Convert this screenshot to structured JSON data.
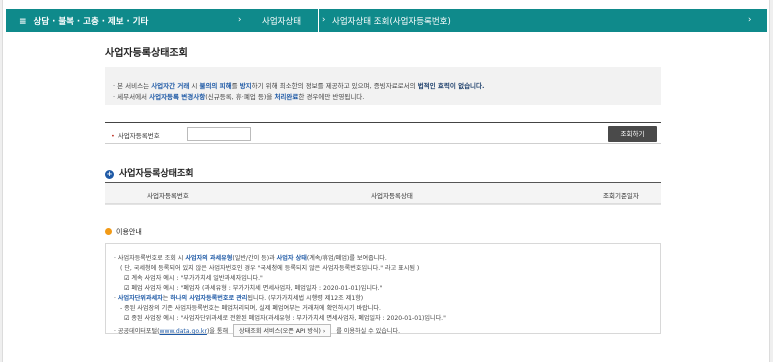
{
  "topbar": {
    "menu_label": "상담 · 불복 · 고충 · 제보 · 기타",
    "crumb1": "사업자상태",
    "crumb2": "사업자상태 조회(사업자등록번호)"
  },
  "page_title": "사업자등록상태조회",
  "notice": {
    "line1_pre": "본 서비스는 ",
    "line1_b1": "사업자간 거래",
    "line1_mid1": " 시 ",
    "line1_b2": "불의의 피해",
    "line1_mid2": "를 ",
    "line1_b3": "방지",
    "line1_mid3": "하기 위해 최소한의 정보를 제공하고 있으며, 증빙자료로서의 ",
    "line1_b4": "법적인 효력이 없습니다.",
    "line2_pre": "세무서에서 ",
    "line2_b1": "사업자등록 변경사항",
    "line2_mid1": "(신규등록, 휴·폐업 등)을 ",
    "line2_b2": "처리완료",
    "line2_post": "한 경우에만 반영됩니다."
  },
  "search": {
    "label": "사업자등록번호",
    "input_value": "",
    "button_label": "조회하기"
  },
  "result_section": {
    "title": "사업자등록상태조회",
    "columns": [
      "사업자등록번호",
      "사업자등록상태",
      "조회기준일자"
    ]
  },
  "guide_section": {
    "title": "이용안내",
    "l1_pre": "· 사업자등록번호로 조회 시 ",
    "l1_b1": "사업자의 과세유형",
    "l1_mid": "(일반/간이 등)과 ",
    "l1_b2": "사업자 상태",
    "l1_post": "(계속/휴업/폐업)를 보여줍니다.",
    "l2": "( 단, 국세청에 등록되어 있지 않은 사업자번호인 경우 \"국세청에 등록되지 않은 사업자등록번호입니다.\" 라고 표시됨 )",
    "l3": "계속 사업자 예시 : \"부가가치세 일반과세자입니다.\"",
    "l4": "폐업 사업자 예시 : \"폐업자 (과세유형 : 부가가치세 면세사업자, 폐업일자 : 2020-01-01)입니다.\"",
    "l5_b1": "사업자단위과세자",
    "l5_mid": "는 ",
    "l5_b2": "하나의 사업자등록번호로 관리",
    "l5_post": "됩니다. (부가가치세법 시행령 제12조 제1항)",
    "l6": "- 종된 사업장의 기존 사업자등록번호는 폐업처리되며, 실제 폐업여부는 거래처에 확인하시기 바랍니다.",
    "l7": "종된 사업장 예시 : \"사업자단위과세로 전환된 폐업자(과세유형 : 부가가치세 면세사업자, 폐업일자 : 2020-01-01)입니다.\"",
    "l8_pre": "· 공공데이터포털(",
    "l8_link": "www.data.go.kr",
    "l8_mid": ")을 통해 ",
    "l8_btn": "상태조회 서비스(오픈 API 방식) ›",
    "l8_post": " 를 이용하실 수 있습니다.",
    "check_mark": "☑"
  },
  "colors": {
    "topbar": "#0f8a8b",
    "accent_blue": "#1f5aa6",
    "required": "#c0392b",
    "orange_dot": "#f29a16"
  }
}
